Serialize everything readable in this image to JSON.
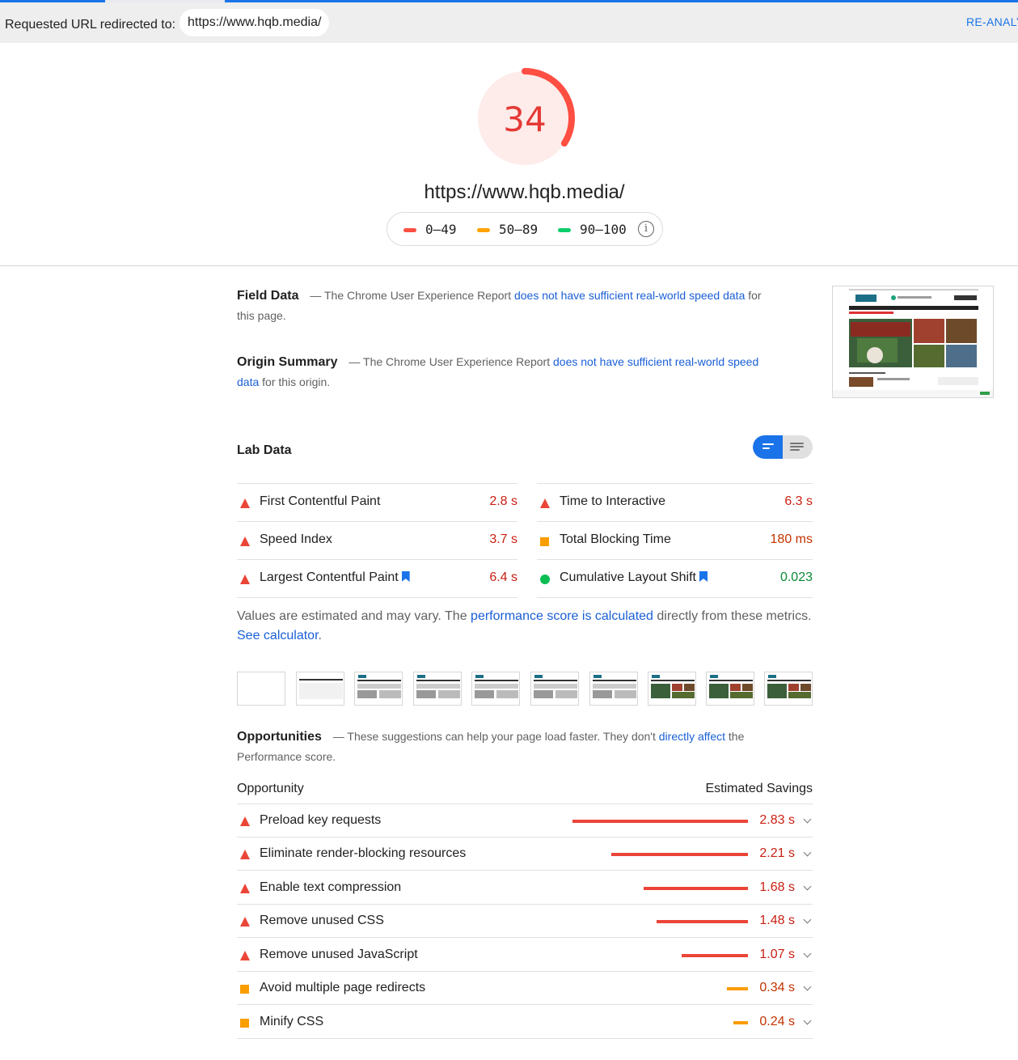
{
  "redirect": {
    "label": "Requested URL redirected to:",
    "url": "https://www.hqb.media/",
    "reanalyze": "RE-ANALYZE"
  },
  "score": {
    "value": "34",
    "fraction": 0.34,
    "url": "https://www.hqb.media/"
  },
  "legend": {
    "fail": "0–49",
    "average": "50–89",
    "pass": "90–100",
    "fail_color": "#ff4e42",
    "average_color": "#ffa400",
    "pass_color": "#0cce6b"
  },
  "field_data": {
    "title": "Field Data",
    "prefix": "— The Chrome User Experience Report",
    "link": "does not have sufficient real-world speed data",
    "suffix": "for this page."
  },
  "origin_summary": {
    "title": "Origin Summary",
    "prefix": "— The Chrome User Experience Report",
    "link": "does not have sufficient real-world speed data",
    "suffix": "for this origin."
  },
  "lab_data": {
    "title": "Lab Data",
    "metrics": [
      {
        "name": "First Contentful Paint",
        "value": "2.8 s",
        "status": "fail"
      },
      {
        "name": "Time to Interactive",
        "value": "6.3 s",
        "status": "fail"
      },
      {
        "name": "Speed Index",
        "value": "3.7 s",
        "status": "fail"
      },
      {
        "name": "Total Blocking Time",
        "value": "180 ms",
        "status": "average"
      },
      {
        "name": "Largest Contentful Paint",
        "value": "6.4 s",
        "status": "fail"
      },
      {
        "name": "Cumulative Layout Shift",
        "value": "0.023",
        "status": "pass"
      }
    ],
    "note_a": "Values are estimated and may vary. The",
    "note_link": "performance score is calculated",
    "note_b": "directly from these metrics.",
    "note_link2": "See calculator",
    "note_end": "."
  },
  "opportunities": {
    "title": "Opportunities",
    "prefix": "— These suggestions can help your page load faster. They don't",
    "link": "directly affect",
    "suffix": "the Performance score.",
    "col_left": "Opportunity",
    "col_right": "Estimated Savings",
    "items": [
      {
        "name": "Preload key requests",
        "value": "2.83 s",
        "seconds": 2.83,
        "status": "fail"
      },
      {
        "name": "Eliminate render-blocking resources",
        "value": "2.21 s",
        "seconds": 2.21,
        "status": "fail"
      },
      {
        "name": "Enable text compression",
        "value": "1.68 s",
        "seconds": 1.68,
        "status": "fail"
      },
      {
        "name": "Remove unused CSS",
        "value": "1.48 s",
        "seconds": 1.48,
        "status": "fail"
      },
      {
        "name": "Remove unused JavaScript",
        "value": "1.07 s",
        "seconds": 1.07,
        "status": "fail"
      },
      {
        "name": "Avoid multiple page redirects",
        "value": "0.34 s",
        "seconds": 0.34,
        "status": "average"
      },
      {
        "name": "Minify CSS",
        "value": "0.24 s",
        "seconds": 0.24,
        "status": "average"
      }
    ]
  },
  "colors": {
    "fail": "#eb4537",
    "average": "#fa9d00",
    "pass": "#0cbe52",
    "link": "#1a5fd6",
    "accent": "#1a73e8"
  }
}
